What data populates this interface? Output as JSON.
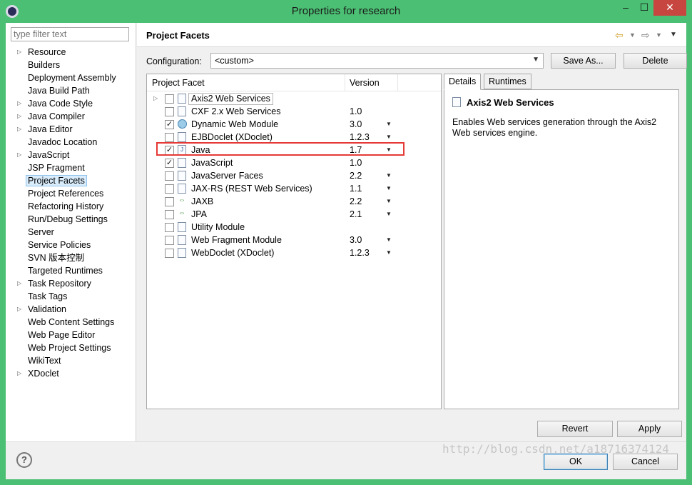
{
  "window": {
    "title": "Properties for research",
    "minimize": "–",
    "maximize": "☐",
    "close": "✕"
  },
  "filter": {
    "placeholder": "type filter text"
  },
  "nav": [
    {
      "label": "Resource",
      "expandable": true
    },
    {
      "label": "Builders",
      "expandable": false
    },
    {
      "label": "Deployment Assembly",
      "expandable": false
    },
    {
      "label": "Java Build Path",
      "expandable": false
    },
    {
      "label": "Java Code Style",
      "expandable": true
    },
    {
      "label": "Java Compiler",
      "expandable": true
    },
    {
      "label": "Java Editor",
      "expandable": true
    },
    {
      "label": "Javadoc Location",
      "expandable": false
    },
    {
      "label": "JavaScript",
      "expandable": true
    },
    {
      "label": "JSP Fragment",
      "expandable": false
    },
    {
      "label": "Project Facets",
      "expandable": false,
      "selected": true
    },
    {
      "label": "Project References",
      "expandable": false
    },
    {
      "label": "Refactoring History",
      "expandable": false
    },
    {
      "label": "Run/Debug Settings",
      "expandable": false
    },
    {
      "label": "Server",
      "expandable": false
    },
    {
      "label": "Service Policies",
      "expandable": false
    },
    {
      "label": "SVN 版本控制",
      "expandable": false
    },
    {
      "label": "Targeted Runtimes",
      "expandable": false
    },
    {
      "label": "Task Repository",
      "expandable": true
    },
    {
      "label": "Task Tags",
      "expandable": false
    },
    {
      "label": "Validation",
      "expandable": true
    },
    {
      "label": "Web Content Settings",
      "expandable": false
    },
    {
      "label": "Web Page Editor",
      "expandable": false
    },
    {
      "label": "Web Project Settings",
      "expandable": false
    },
    {
      "label": "WikiText",
      "expandable": false
    },
    {
      "label": "XDoclet",
      "expandable": true
    }
  ],
  "page": {
    "title": "Project Facets"
  },
  "configuration": {
    "label": "Configuration:",
    "value": "<custom>",
    "save_as": "Save As...",
    "delete": "Delete"
  },
  "facets": {
    "header_facet": "Project Facet",
    "header_version": "Version",
    "rows": [
      {
        "name": "Axis2 Web Services",
        "version": "",
        "checked": false,
        "expandable": true,
        "dropdown": false,
        "icon": "document-icon",
        "highlight": true
      },
      {
        "name": "CXF 2.x Web Services",
        "version": "1.0",
        "checked": false,
        "dropdown": false,
        "icon": "document-icon"
      },
      {
        "name": "Dynamic Web Module",
        "version": "3.0",
        "checked": true,
        "dropdown": true,
        "icon": "web-module-icon"
      },
      {
        "name": "EJBDoclet (XDoclet)",
        "version": "1.2.3",
        "checked": false,
        "dropdown": true,
        "icon": "document-icon"
      },
      {
        "name": "Java",
        "version": "1.7",
        "checked": true,
        "dropdown": true,
        "icon": "java-icon"
      },
      {
        "name": "JavaScript",
        "version": "1.0",
        "checked": true,
        "dropdown": false,
        "icon": "document-icon"
      },
      {
        "name": "JavaServer Faces",
        "version": "2.2",
        "checked": false,
        "dropdown": true,
        "icon": "document-icon"
      },
      {
        "name": "JAX-RS (REST Web Services)",
        "version": "1.1",
        "checked": false,
        "dropdown": true,
        "icon": "document-icon"
      },
      {
        "name": "JAXB",
        "version": "2.2",
        "checked": false,
        "dropdown": true,
        "icon": "exchange-icon"
      },
      {
        "name": "JPA",
        "version": "2.1",
        "checked": false,
        "dropdown": true,
        "icon": "exchange-icon"
      },
      {
        "name": "Utility Module",
        "version": "",
        "checked": false,
        "dropdown": false,
        "icon": "document-icon"
      },
      {
        "name": "Web Fragment Module",
        "version": "3.0",
        "checked": false,
        "dropdown": true,
        "icon": "document-icon"
      },
      {
        "name": "WebDoclet (XDoclet)",
        "version": "1.2.3",
        "checked": false,
        "dropdown": true,
        "icon": "document-icon"
      }
    ]
  },
  "details": {
    "tabs": [
      "Details",
      "Runtimes"
    ],
    "title": "Axis2 Web Services",
    "description": "Enables Web services generation through the Axis2 Web services engine."
  },
  "buttons": {
    "revert": "Revert",
    "apply": "Apply",
    "ok": "OK",
    "cancel": "Cancel",
    "help": "?"
  },
  "watermark": "http://blog.csdn.net/a18716374124",
  "colors": {
    "frame": "#4bbf73",
    "highlight_box": "#e53935",
    "selection": "#d9ecfb"
  }
}
